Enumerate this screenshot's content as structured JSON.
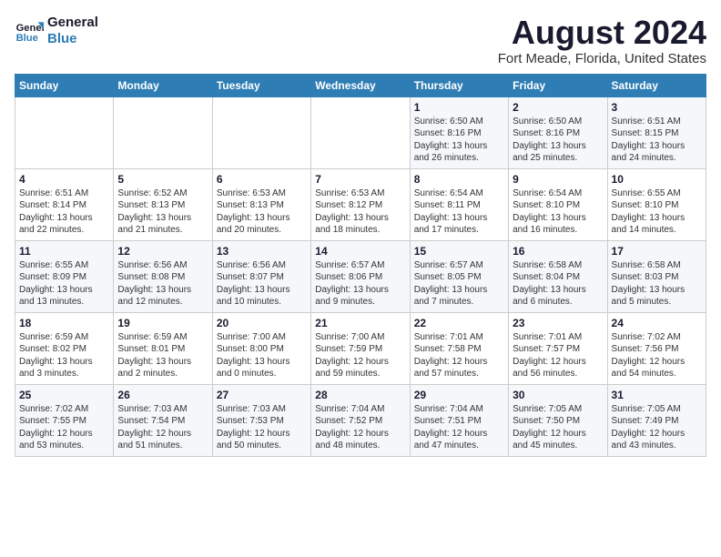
{
  "logo": {
    "line1": "General",
    "line2": "Blue"
  },
  "title": "August 2024",
  "subtitle": "Fort Meade, Florida, United States",
  "headers": [
    "Sunday",
    "Monday",
    "Tuesday",
    "Wednesday",
    "Thursday",
    "Friday",
    "Saturday"
  ],
  "weeks": [
    [
      {
        "day": "",
        "info": ""
      },
      {
        "day": "",
        "info": ""
      },
      {
        "day": "",
        "info": ""
      },
      {
        "day": "",
        "info": ""
      },
      {
        "day": "1",
        "info": "Sunrise: 6:50 AM\nSunset: 8:16 PM\nDaylight: 13 hours\nand 26 minutes."
      },
      {
        "day": "2",
        "info": "Sunrise: 6:50 AM\nSunset: 8:16 PM\nDaylight: 13 hours\nand 25 minutes."
      },
      {
        "day": "3",
        "info": "Sunrise: 6:51 AM\nSunset: 8:15 PM\nDaylight: 13 hours\nand 24 minutes."
      }
    ],
    [
      {
        "day": "4",
        "info": "Sunrise: 6:51 AM\nSunset: 8:14 PM\nDaylight: 13 hours\nand 22 minutes."
      },
      {
        "day": "5",
        "info": "Sunrise: 6:52 AM\nSunset: 8:13 PM\nDaylight: 13 hours\nand 21 minutes."
      },
      {
        "day": "6",
        "info": "Sunrise: 6:53 AM\nSunset: 8:13 PM\nDaylight: 13 hours\nand 20 minutes."
      },
      {
        "day": "7",
        "info": "Sunrise: 6:53 AM\nSunset: 8:12 PM\nDaylight: 13 hours\nand 18 minutes."
      },
      {
        "day": "8",
        "info": "Sunrise: 6:54 AM\nSunset: 8:11 PM\nDaylight: 13 hours\nand 17 minutes."
      },
      {
        "day": "9",
        "info": "Sunrise: 6:54 AM\nSunset: 8:10 PM\nDaylight: 13 hours\nand 16 minutes."
      },
      {
        "day": "10",
        "info": "Sunrise: 6:55 AM\nSunset: 8:10 PM\nDaylight: 13 hours\nand 14 minutes."
      }
    ],
    [
      {
        "day": "11",
        "info": "Sunrise: 6:55 AM\nSunset: 8:09 PM\nDaylight: 13 hours\nand 13 minutes."
      },
      {
        "day": "12",
        "info": "Sunrise: 6:56 AM\nSunset: 8:08 PM\nDaylight: 13 hours\nand 12 minutes."
      },
      {
        "day": "13",
        "info": "Sunrise: 6:56 AM\nSunset: 8:07 PM\nDaylight: 13 hours\nand 10 minutes."
      },
      {
        "day": "14",
        "info": "Sunrise: 6:57 AM\nSunset: 8:06 PM\nDaylight: 13 hours\nand 9 minutes."
      },
      {
        "day": "15",
        "info": "Sunrise: 6:57 AM\nSunset: 8:05 PM\nDaylight: 13 hours\nand 7 minutes."
      },
      {
        "day": "16",
        "info": "Sunrise: 6:58 AM\nSunset: 8:04 PM\nDaylight: 13 hours\nand 6 minutes."
      },
      {
        "day": "17",
        "info": "Sunrise: 6:58 AM\nSunset: 8:03 PM\nDaylight: 13 hours\nand 5 minutes."
      }
    ],
    [
      {
        "day": "18",
        "info": "Sunrise: 6:59 AM\nSunset: 8:02 PM\nDaylight: 13 hours\nand 3 minutes."
      },
      {
        "day": "19",
        "info": "Sunrise: 6:59 AM\nSunset: 8:01 PM\nDaylight: 13 hours\nand 2 minutes."
      },
      {
        "day": "20",
        "info": "Sunrise: 7:00 AM\nSunset: 8:00 PM\nDaylight: 13 hours\nand 0 minutes."
      },
      {
        "day": "21",
        "info": "Sunrise: 7:00 AM\nSunset: 7:59 PM\nDaylight: 12 hours\nand 59 minutes."
      },
      {
        "day": "22",
        "info": "Sunrise: 7:01 AM\nSunset: 7:58 PM\nDaylight: 12 hours\nand 57 minutes."
      },
      {
        "day": "23",
        "info": "Sunrise: 7:01 AM\nSunset: 7:57 PM\nDaylight: 12 hours\nand 56 minutes."
      },
      {
        "day": "24",
        "info": "Sunrise: 7:02 AM\nSunset: 7:56 PM\nDaylight: 12 hours\nand 54 minutes."
      }
    ],
    [
      {
        "day": "25",
        "info": "Sunrise: 7:02 AM\nSunset: 7:55 PM\nDaylight: 12 hours\nand 53 minutes."
      },
      {
        "day": "26",
        "info": "Sunrise: 7:03 AM\nSunset: 7:54 PM\nDaylight: 12 hours\nand 51 minutes."
      },
      {
        "day": "27",
        "info": "Sunrise: 7:03 AM\nSunset: 7:53 PM\nDaylight: 12 hours\nand 50 minutes."
      },
      {
        "day": "28",
        "info": "Sunrise: 7:04 AM\nSunset: 7:52 PM\nDaylight: 12 hours\nand 48 minutes."
      },
      {
        "day": "29",
        "info": "Sunrise: 7:04 AM\nSunset: 7:51 PM\nDaylight: 12 hours\nand 47 minutes."
      },
      {
        "day": "30",
        "info": "Sunrise: 7:05 AM\nSunset: 7:50 PM\nDaylight: 12 hours\nand 45 minutes."
      },
      {
        "day": "31",
        "info": "Sunrise: 7:05 AM\nSunset: 7:49 PM\nDaylight: 12 hours\nand 43 minutes."
      }
    ]
  ]
}
